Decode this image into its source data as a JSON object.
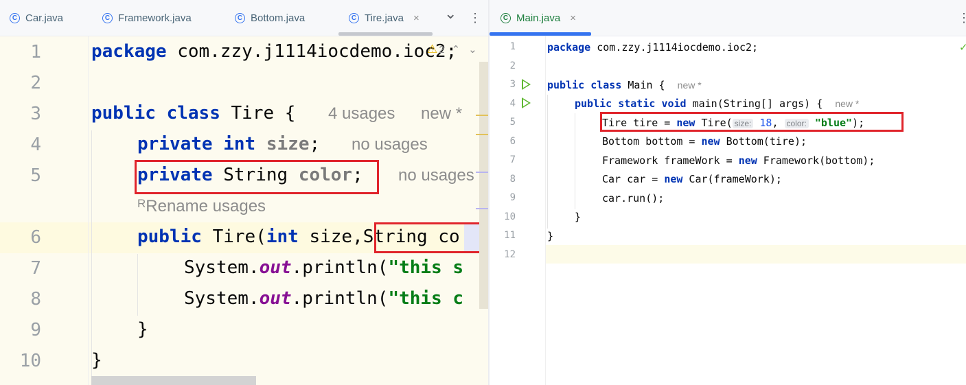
{
  "left_tabs": [
    {
      "label": "Car.java",
      "icon": "class-icon"
    },
    {
      "label": "Framework.java",
      "icon": "class-icon"
    },
    {
      "label": "Bottom.java",
      "icon": "class-icon"
    },
    {
      "label": "Tire.java",
      "icon": "class-icon",
      "active": true
    }
  ],
  "right_tabs": [
    {
      "label": "Main.java",
      "icon": "class-run-icon",
      "active": true
    }
  ],
  "close_glyph": "×",
  "more_glyph": "⋮",
  "chevron_glyph": "⌄",
  "left_editor": {
    "warning_count": "2",
    "line_numbers": [
      "1",
      "2",
      "3",
      "4",
      "5",
      "6",
      "7",
      "8",
      "9",
      "10"
    ],
    "lines": {
      "l1_kw": "package",
      "l1_rest": " com.zzy.j1114iocdemo.ioc2;",
      "l3_kw1": "public",
      "l3_kw2": "class",
      "l3_name": " Tire {",
      "l3_hint1": "4 usages",
      "l3_hint2": "new *",
      "l4_kw1": "private",
      "l4_kw2": "int",
      "l4_field": "size",
      "l4_semi": ";",
      "l4_hint": "no usages",
      "l5_kw": "private",
      "l5_type": " String ",
      "l5_field": "color",
      "l5_semi": ";",
      "l5_hint": "no usages",
      "rename_hint": "Rename usages",
      "l6_kw1": "public",
      "l6_mid": " Tire(",
      "l6_kw2": "int",
      "l6_rest": " size,String co",
      "l7_pre": "System.",
      "l7_out": "out",
      "l7_call": ".println(",
      "l7_str": "\"this s",
      "l8_pre": "System.",
      "l8_out": "out",
      "l8_call": ".println(",
      "l8_str": "\"this c",
      "l9": "}",
      "l10": "}"
    }
  },
  "right_editor": {
    "line_numbers": [
      "1",
      "2",
      "3",
      "4",
      "5",
      "6",
      "7",
      "8",
      "9",
      "10",
      "11",
      "12"
    ],
    "lines": {
      "l1_kw": "package",
      "l1_rest": " com.zzy.j1114iocdemo.ioc2;",
      "l3_kw1": "public",
      "l3_kw2": "class",
      "l3_rest": " Main {",
      "l3_hint": "new *",
      "l4_kw1": "public",
      "l4_kw2": "static",
      "l4_kw3": "void",
      "l4_rest": " main(String[] args) {",
      "l4_hint": "new *",
      "l5_pre": "Tire tire = ",
      "l5_kw": "new",
      "l5_call": " Tire(",
      "l5_hint_size": "size:",
      "l5_num": "18",
      "l5_comma": ", ",
      "l5_hint_color": "color:",
      "l5_str": "\"blue\"",
      "l5_end": ");",
      "l6_pre": "Bottom bottom = ",
      "l6_kw": "new",
      "l6_rest": " Bottom(tire);",
      "l7_pre": "Framework frameWork = ",
      "l7_kw": "new",
      "l7_rest": " Framework(bottom);",
      "l8_pre": "Car car = ",
      "l8_kw": "new",
      "l8_rest": " Car(frameWork);",
      "l9": "car.run();",
      "l10": "}",
      "l11": "}"
    }
  },
  "colors": {
    "keyword": "#0033b3",
    "string": "#067d17",
    "field": "#871094",
    "highlight_box": "#e0242b",
    "active_tab_underline": "#3574f0"
  }
}
